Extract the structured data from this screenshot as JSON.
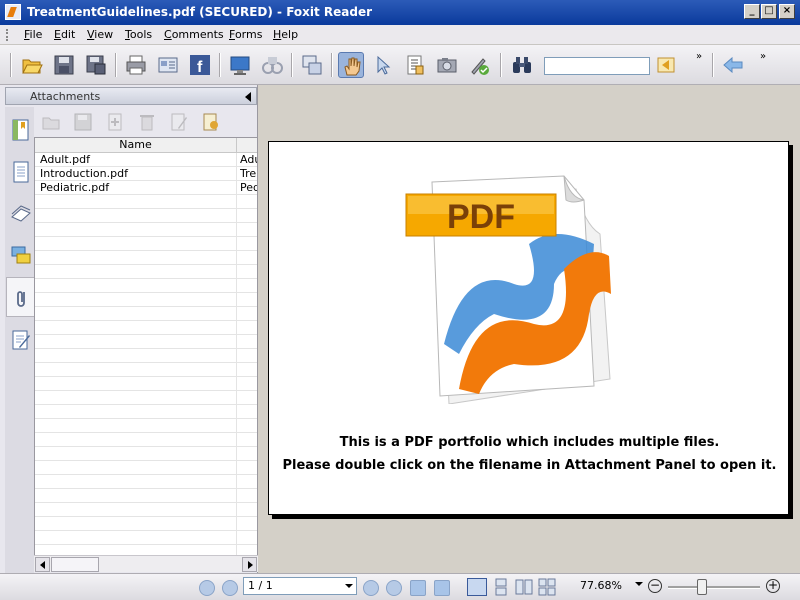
{
  "window": {
    "title": "TreatmentGuidelines.pdf (SECURED) - Foxit Reader",
    "minimize_label": "_",
    "maximize_label": "□",
    "close_label": "×"
  },
  "menu": [
    "File",
    "Edit",
    "View",
    "Tools",
    "Comments",
    "Forms",
    "Help"
  ],
  "toolbar": {
    "overflow_label": "»",
    "icons": [
      "open-folder-icon",
      "save-icon",
      "save-as-icon",
      "print-icon",
      "email-icon",
      "facebook-icon",
      "screen-icon",
      "ebook-icon",
      "snapshot-icon",
      "hand-tool-icon",
      "select-tool-icon",
      "text-select-icon",
      "camera-icon",
      "sign-icon",
      "binoculars-icon",
      "find-previous-icon",
      "back-arrow-icon"
    ],
    "search_value": ""
  },
  "sidebar": {
    "panel_title": "Attachments",
    "tabs": [
      "bookmarks-icon",
      "pages-icon",
      "layers-icon",
      "comments-icon",
      "attachments-icon",
      "signatures-icon"
    ],
    "active_tab": "attachments-icon",
    "grid": {
      "columns": [
        "Name",
        ""
      ],
      "rows": [
        {
          "name": "Adult.pdf",
          "desc": "Adu"
        },
        {
          "name": "Introduction.pdf",
          "desc": "Tre"
        },
        {
          "name": "Pediatric.pdf",
          "desc": "Ped"
        }
      ]
    }
  },
  "document": {
    "logo_text": "PDF",
    "line1": "This is a PDF portfolio which includes multiple files.",
    "line2": "Please double click on the filename in Attachment Panel to open it."
  },
  "status": {
    "page_value": "1 / 1",
    "zoom_value": "77.68%",
    "zoom_out_label": "−",
    "zoom_in_label": "+",
    "zoom_slider_fraction": 0.38
  },
  "colors": {
    "titlebar": "#0a3a9c",
    "pdf_label": "#f6a800",
    "swoosh_orange": "#f27a0b",
    "swoosh_blue": "#3b8ad6"
  }
}
